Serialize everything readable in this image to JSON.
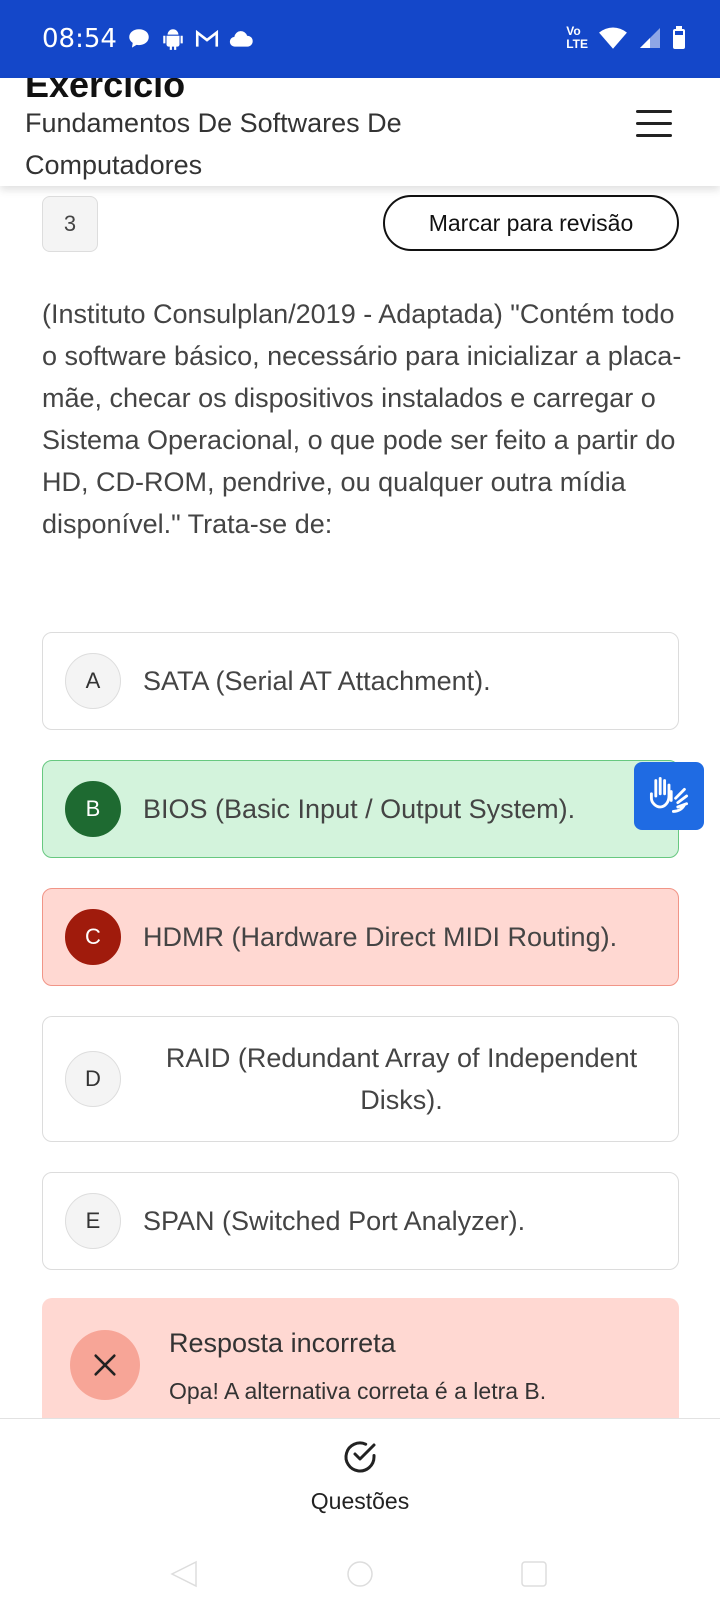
{
  "status_bar": {
    "time": "08:54",
    "left_icons": [
      "chat-bubble-icon",
      "android-icon",
      "gmail-icon",
      "cloud-icon"
    ],
    "volte_label_1": "Vo",
    "volte_label_2": "LTE",
    "right_icons": [
      "wifi-icon",
      "signal-icon",
      "battery-icon"
    ],
    "color": "#1447c9"
  },
  "header": {
    "title": "Exercício",
    "subtitle": "Fundamentos De Softwares De Computadores",
    "menu_icon": "hamburger-menu-icon"
  },
  "question": {
    "number": "3",
    "review_label": "Marcar para revisão",
    "text": "(Instituto Consulplan/2019 - Adaptada) \"Contém todo o software básico, necessário para inicializar a placa-mãe, checar os dispositivos instalados e carregar o Sistema Operacional, o que pode ser feito a partir do HD, CD-ROM, pendrive, ou qualquer outra mídia disponível.\" Trata-se de:"
  },
  "options": [
    {
      "letter": "A",
      "text": "SATA (Serial AT Attachment).",
      "state": "neutral"
    },
    {
      "letter": "B",
      "text": "BIOS (Basic Input / Output System).",
      "state": "correct"
    },
    {
      "letter": "C",
      "text": "HDMR (Hardware Direct MIDI Routing).",
      "state": "wrong"
    },
    {
      "letter": "D",
      "text": "RAID (Redundant Array of Independent Disks).",
      "state": "neutral"
    },
    {
      "letter": "E",
      "text": "SPAN (Switched Port Analyzer).",
      "state": "neutral"
    }
  ],
  "accessibility_button": {
    "icon": "sign-language-hands-icon",
    "color": "#1f6be3"
  },
  "feedback": {
    "title": "Resposta incorreta",
    "text": "Opa! A alternativa correta é a letra B.",
    "icon": "close-x-icon"
  },
  "bottom_nav": {
    "label": "Questões",
    "icon": "check-circle-icon"
  },
  "colors": {
    "correct_bg": "#d3f3dc",
    "correct_badge": "#1e6a31",
    "wrong_bg": "#ffd8d2",
    "wrong_badge": "#a01b0c"
  }
}
